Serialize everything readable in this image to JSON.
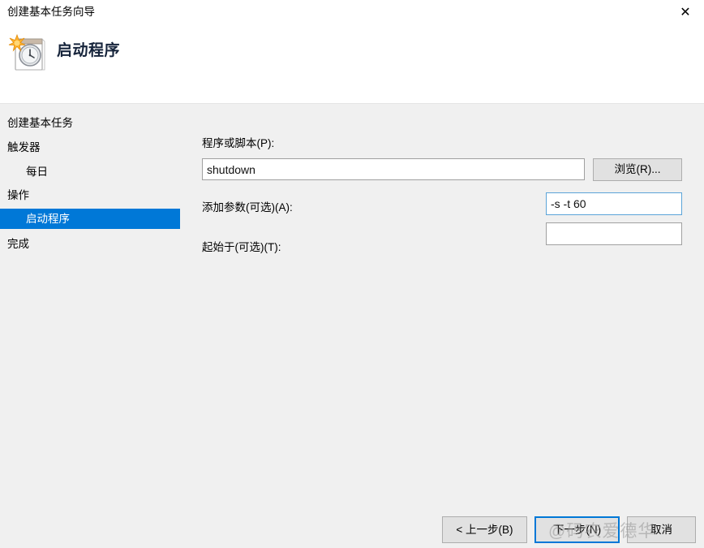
{
  "window": {
    "title": "创建基本任务向导",
    "close_icon": "close-icon"
  },
  "header": {
    "heading": "启动程序",
    "icon": "task-scheduler-calendar-clock-icon"
  },
  "sidebar": {
    "items": [
      {
        "label": "创建基本任务",
        "level": 0,
        "selected": false
      },
      {
        "label": "触发器",
        "level": 0,
        "selected": false
      },
      {
        "label": "每日",
        "level": 1,
        "selected": false
      },
      {
        "label": "操作",
        "level": 0,
        "selected": false
      },
      {
        "label": "启动程序",
        "level": 1,
        "selected": true
      },
      {
        "label": "完成",
        "level": 0,
        "selected": false
      }
    ],
    "selected_color": "#0078d7"
  },
  "form": {
    "program": {
      "label": "程序或脚本(P):",
      "value": "shutdown",
      "placeholder": "",
      "focused": false
    },
    "browse_button": {
      "label": "浏览(R)..."
    },
    "arguments": {
      "label": "添加参数(可选)(A):",
      "value": "-s -t 60",
      "placeholder": "",
      "focused": true
    },
    "start_in": {
      "label": "起始于(可选)(T):",
      "value": "",
      "placeholder": "",
      "focused": false
    }
  },
  "footer": {
    "back_button": {
      "label": "< 上一步(B)"
    },
    "next_button": {
      "label": "下一步(N)",
      "focused": true
    },
    "cancel_button": {
      "label": "取消"
    }
  },
  "watermark": {
    "text": "@码农爱德华"
  }
}
